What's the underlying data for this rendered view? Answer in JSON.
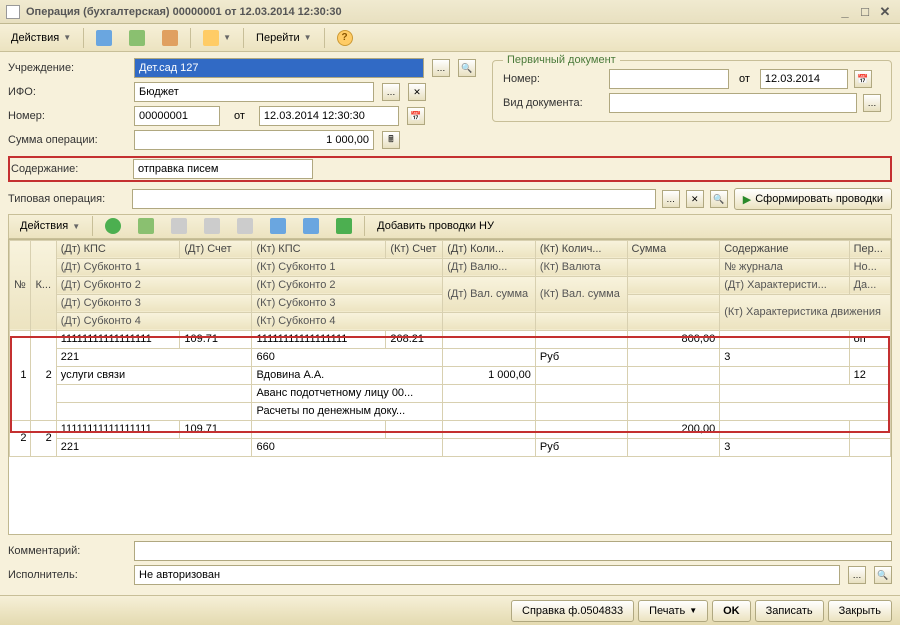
{
  "window": {
    "title": "Операция (бухгалтерская) 00000001 от 12.03.2014 12:30:30"
  },
  "toolbar": {
    "actions": "Действия",
    "goto": "Перейти"
  },
  "form": {
    "institution_label": "Учреждение:",
    "institution_value": "Дет.сад 127",
    "ifo_label": "ИФО:",
    "ifo_value": "Бюджет",
    "number_label": "Номер:",
    "number_value": "00000001",
    "date_from_label": "от",
    "date_value": "12.03.2014 12:30:30",
    "sum_label": "Сумма операции:",
    "sum_value": "1 000,00",
    "content_label": "Содержание:",
    "content_value": "отправка писем",
    "typop_label": "Типовая операция:",
    "typop_value": "",
    "form_btn": "Сформировать проводки"
  },
  "primary_doc": {
    "legend": "Первичный документ",
    "number_label": "Номер:",
    "number_value": "",
    "from_label": "от",
    "date_value": "12.03.2014",
    "type_label": "Вид документа:",
    "type_value": ""
  },
  "subtoolbar": {
    "actions": "Действия",
    "add_nu": "Добавить проводки НУ"
  },
  "grid": {
    "headers": {
      "n": "№",
      "k": "К...",
      "dt_kps": "(Дт) КПС",
      "dt_acct": "(Дт) Счет",
      "kt_kps": "(Кт) КПС",
      "kt_acct": "(Кт) Счет",
      "dt_qty": "(Дт) Коли...",
      "kt_qty": "(Кт) Колич...",
      "sum": "Сумма",
      "content": "Содержание",
      "per": "Пер...",
      "dt_sub1": "(Дт) Субконто 1",
      "kt_sub1": "(Кт) Субконто 1",
      "dt_cur": "(Дт) Валю...",
      "kt_cur": "(Кт) Валюта",
      "journal": "№ журнала",
      "no": "Но...",
      "dt_sub2": "(Дт) Субконто 2",
      "kt_sub2": "(Кт) Субконто 2",
      "dt_valsum": "(Дт) Вал. сумма",
      "kt_valsum": "(Кт) Вал. сумма",
      "dt_char": "(Дт) Характеристи...",
      "da": "Да...",
      "dt_sub3": "(Дт) Субконто 3",
      "kt_sub3": "(Кт) Субконто 3",
      "kt_char": "(Кт) Характеристика движения",
      "dt_sub4": "(Дт) Субконто 4",
      "kt_sub4": "(Кт) Субконто 4"
    },
    "rows": [
      {
        "n": "1",
        "k": "2",
        "dt_kps": "11111111111111111",
        "dt_acct": "109.71",
        "kt_kps": "11111111111111111",
        "kt_acct": "208.21",
        "sum": "800,00",
        "content_trunc": "оп",
        "dt_sub1": "221",
        "kt_sub1": "660",
        "kt_cur": "Руб",
        "journal": "3",
        "dt_sub2": "услуги связи",
        "kt_sub2": "Вдовина А.А.",
        "dt_valsum": "1 000,00",
        "no": "12",
        "kt_sub3": "Аванс подотчетному лицу 00...",
        "kt_sub4": "Расчеты по денежным доку..."
      },
      {
        "n": "2",
        "k": "2",
        "dt_kps": "11111111111111111",
        "dt_acct": "109.71",
        "sum": "200,00",
        "dt_sub1": "221",
        "kt_sub1": "660",
        "kt_cur": "Руб",
        "journal": "3"
      }
    ]
  },
  "bottom": {
    "comment_label": "Комментарий:",
    "comment_value": "",
    "executor_label": "Исполнитель:",
    "executor_value": "Не авторизован"
  },
  "footer": {
    "ref": "Справка ф.0504833",
    "print": "Печать",
    "ok": "OK",
    "save": "Записать",
    "close": "Закрыть"
  }
}
